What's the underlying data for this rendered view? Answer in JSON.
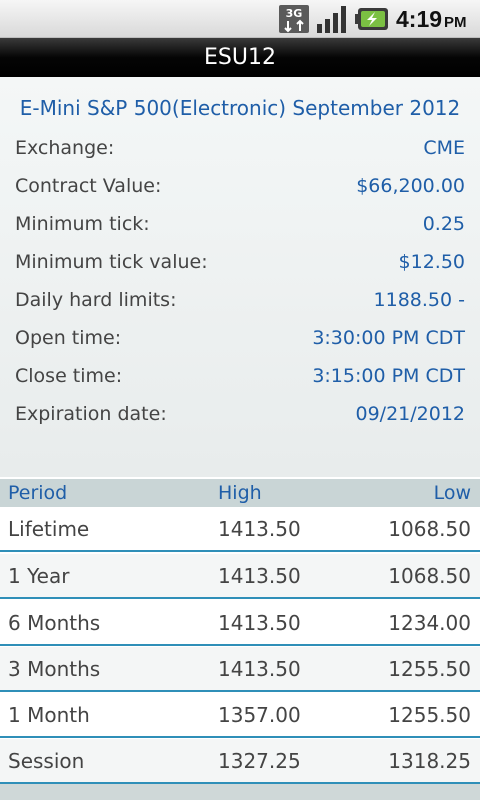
{
  "status_bar": {
    "network_type": "3G",
    "time": "4:19",
    "ampm": "PM",
    "icons": [
      "3g-data-icon",
      "signal-strength-icon",
      "battery-charging-icon"
    ]
  },
  "header": {
    "title": "ESU12"
  },
  "contract": {
    "name": "E-Mini S&P 500(Electronic) September 2012",
    "details": [
      {
        "label": "Exchange:",
        "value": "CME"
      },
      {
        "label": "Contract Value:",
        "value": "$66,200.00"
      },
      {
        "label": "Minimum tick:",
        "value": "0.25"
      },
      {
        "label": "Minimum tick value:",
        "value": "$12.50"
      },
      {
        "label": "Daily hard limits:",
        "value": "1188.50 -"
      },
      {
        "label": "Open time:",
        "value": "3:30:00 PM CDT"
      },
      {
        "label": "Close time:",
        "value": "3:15:00 PM CDT"
      },
      {
        "label": "Expiration date:",
        "value": "09/21/2012"
      }
    ]
  },
  "ranges": {
    "columns": [
      "Period",
      "High",
      "Low"
    ],
    "rows": [
      {
        "period": "Lifetime",
        "high": "1413.50",
        "low": "1068.50"
      },
      {
        "period": "1 Year",
        "high": "1413.50",
        "low": "1068.50"
      },
      {
        "period": "6 Months",
        "high": "1413.50",
        "low": "1234.00"
      },
      {
        "period": "3 Months",
        "high": "1413.50",
        "low": "1255.50"
      },
      {
        "period": "1 Month",
        "high": "1357.00",
        "low": "1255.50"
      },
      {
        "period": "Session",
        "high": "1327.25",
        "low": "1318.25"
      }
    ]
  },
  "colors": {
    "accent_blue": "#1f5ea8",
    "divider_blue": "#2f8fb8",
    "battery_green": "#7bc043"
  }
}
